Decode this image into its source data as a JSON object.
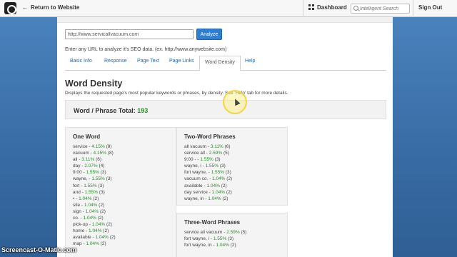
{
  "topbar": {
    "back_label": "Return to Website",
    "back_arrow": "←",
    "dashboard_label": "Dashboard",
    "search_placeholder": "Intelligent Search",
    "signout_label": "Sign Out"
  },
  "analyzer": {
    "url_value": "http://www.servicallvacuum.com",
    "analyze_label": "Analyze",
    "hint": "Enter any URL to analyze it's SEO data. (ex. http://www.anywebsite.com)"
  },
  "tabs": [
    "Basic Info",
    "Response",
    "Page Text",
    "Page Links",
    "Word Density",
    "Help"
  ],
  "active_tab": "Word Density",
  "section": {
    "title": "Word Density",
    "description": "Displays the requested page's most popular keywords or phrases, by density.  See 'Help' tab for more details."
  },
  "total": {
    "label": "Word / Phrase Total:",
    "value": "193"
  },
  "one_word": {
    "title": "One Word",
    "items": [
      {
        "term": "service",
        "pct": "4.15%",
        "count": "(8)"
      },
      {
        "term": "vacuum",
        "pct": "4.15%",
        "count": "(8)"
      },
      {
        "term": "all",
        "pct": "3.11%",
        "count": "(6)"
      },
      {
        "term": "day",
        "pct": "2.07%",
        "count": "(4)"
      },
      {
        "term": "9:00",
        "pct": "1.55%",
        "count": "(3)"
      },
      {
        "term": "wayne,",
        "pct": "1.55%",
        "count": "(3)"
      },
      {
        "term": "fort",
        "pct": "1.55%",
        "count": "(3)"
      },
      {
        "term": "and",
        "pct": "1.55%",
        "count": "(3)"
      },
      {
        "term": "•",
        "pct": "1.04%",
        "count": "(2)"
      },
      {
        "term": "site",
        "pct": "1.04%",
        "count": "(2)"
      },
      {
        "term": "sign",
        "pct": "1.04%",
        "count": "(2)"
      },
      {
        "term": "co.",
        "pct": "1.04%",
        "count": "(2)"
      },
      {
        "term": "pick-up",
        "pct": "1.04%",
        "count": "(2)"
      },
      {
        "term": "home",
        "pct": "1.04%",
        "count": "(2)"
      },
      {
        "term": "available",
        "pct": "1.04%",
        "count": "(2)"
      },
      {
        "term": "map",
        "pct": "1.04%",
        "count": "(2)"
      }
    ]
  },
  "two_word": {
    "title": "Two-Word Phrases",
    "items": [
      {
        "term": "all vacuum",
        "pct": "3.11%",
        "count": "(6)"
      },
      {
        "term": "service all",
        "pct": "2.59%",
        "count": "(5)"
      },
      {
        "term": "9:00 -",
        "pct": "1.55%",
        "count": "(3)"
      },
      {
        "term": "wayne, i",
        "pct": "1.55%",
        "count": "(3)"
      },
      {
        "term": "fort wayne,",
        "pct": "1.55%",
        "count": "(3)"
      },
      {
        "term": "vacuum co.",
        "pct": "1.04%",
        "count": "(2)"
      },
      {
        "term": "available",
        "pct": "1.04%",
        "count": "(2)"
      },
      {
        "term": "day service",
        "pct": "1.04%",
        "count": "(2)"
      },
      {
        "term": "wayne, in",
        "pct": "1.04%",
        "count": "(2)"
      }
    ]
  },
  "three_word": {
    "title": "Three-Word Phrases",
    "items": [
      {
        "term": "service all vacuum",
        "pct": "2.59%",
        "count": "(5)"
      },
      {
        "term": "fort wayne, i",
        "pct": "1.55%",
        "count": "(3)"
      },
      {
        "term": "fort wayne, in",
        "pct": "1.04%",
        "count": "(2)"
      }
    ]
  },
  "watermark": "Screencast-O-Matic.com",
  "colors": {
    "accent": "#2e7fd1",
    "percent_green": "#2f8a2f",
    "link_blue": "#2a66b3",
    "backdrop_blue": "#3b6fa6"
  },
  "icons": [
    "app-logo-icon",
    "back-arrow-icon",
    "dashboard-grid-icon",
    "search-icon",
    "mouse-cursor-icon"
  ]
}
